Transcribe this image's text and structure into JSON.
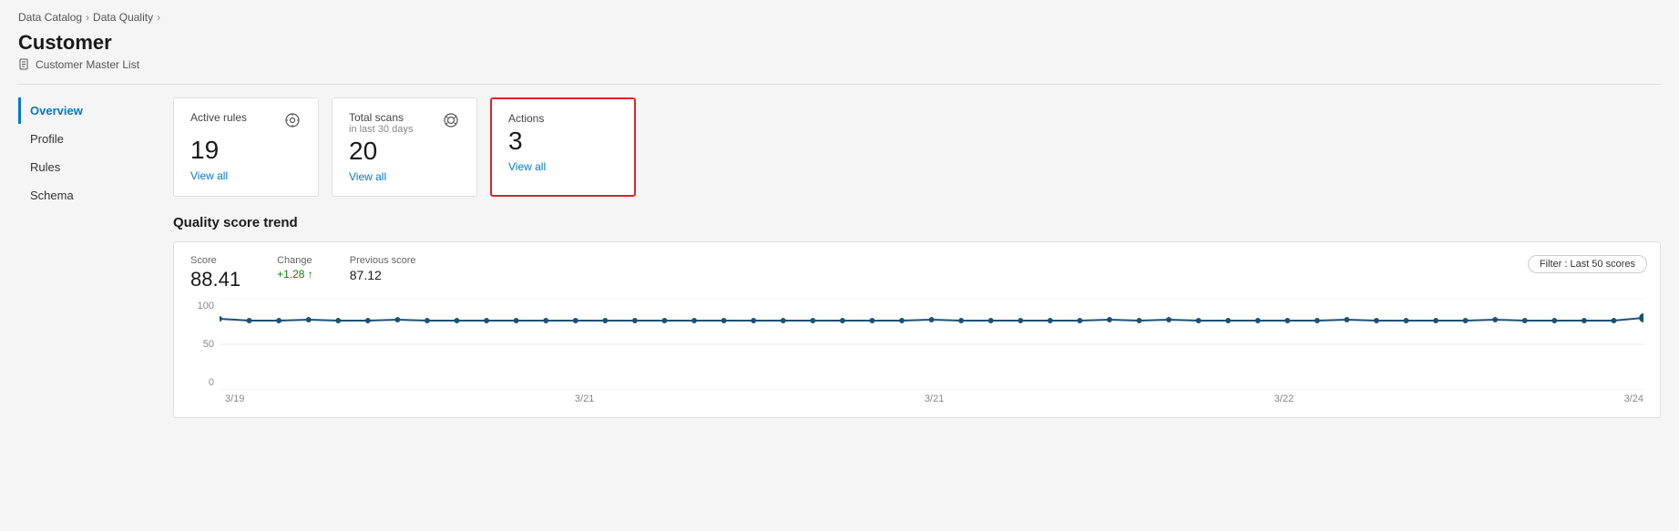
{
  "breadcrumb": {
    "items": [
      "Data Catalog",
      "Data Quality"
    ]
  },
  "page": {
    "title": "Customer",
    "subtitle": "Customer Master List"
  },
  "sidebar": {
    "items": [
      {
        "label": "Overview",
        "active": true
      },
      {
        "label": "Profile",
        "active": false
      },
      {
        "label": "Rules",
        "active": false
      },
      {
        "label": "Schema",
        "active": false
      }
    ]
  },
  "cards": [
    {
      "title": "Active rules",
      "subtitle": "",
      "value": "19",
      "link_label": "View all",
      "highlighted": false,
      "has_icon": true,
      "icon": "⚙"
    },
    {
      "title": "Total scans",
      "subtitle": "in last 30 days",
      "value": "20",
      "link_label": "View all",
      "highlighted": false,
      "has_icon": true,
      "icon": "◎"
    },
    {
      "title": "Actions",
      "subtitle": "",
      "value": "3",
      "link_label": "View all",
      "highlighted": true,
      "has_icon": false,
      "icon": ""
    }
  ],
  "chart": {
    "section_title": "Quality score trend",
    "score_label": "Score",
    "score_value": "88.41",
    "change_label": "Change",
    "change_value": "+1.28 ↑",
    "prev_score_label": "Previous score",
    "prev_score_value": "87.12",
    "filter_label": "Filter : Last 50 scores",
    "y_labels": [
      "100",
      "50",
      "0"
    ],
    "x_labels": [
      "3/19",
      "3/21",
      "3/21",
      "3/22",
      "3/24"
    ],
    "data_points": [
      78,
      76,
      76,
      77,
      76,
      76,
      77,
      76,
      76,
      76,
      76,
      76,
      76,
      76,
      76,
      76,
      76,
      76,
      76,
      76,
      76,
      76,
      76,
      76,
      77,
      76,
      76,
      76,
      76,
      76,
      77,
      76,
      77,
      76,
      76,
      76,
      76,
      76,
      77,
      76,
      76,
      76,
      76,
      77,
      76,
      76,
      76,
      76,
      79
    ]
  }
}
